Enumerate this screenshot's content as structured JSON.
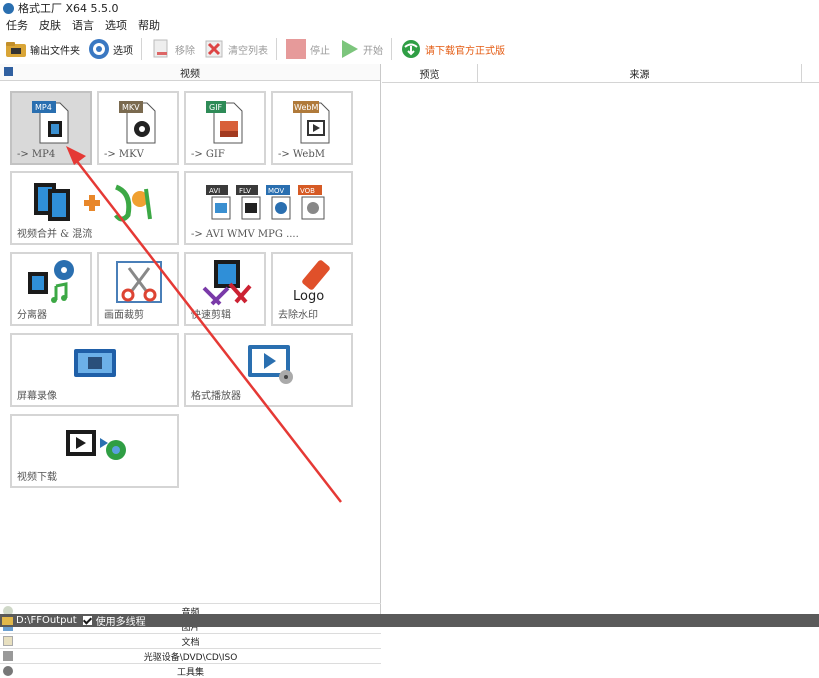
{
  "window": {
    "title": "格式工厂 X64 5.5.0"
  },
  "menu": [
    "任务",
    "皮肤",
    "语言",
    "选项",
    "帮助"
  ],
  "toolbar": {
    "output_folder": "输出文件夹",
    "options": "选项",
    "remove": "移除",
    "clear_list": "清空列表",
    "stop": "停止",
    "start": "开始",
    "download_official": "请下载官方正式版"
  },
  "left": {
    "video_header": "视频",
    "tiles": [
      {
        "label": "-> MP4",
        "badge": "MP4",
        "icon": "mp4-file-icon"
      },
      {
        "label": "-> MKV",
        "badge": "MKV",
        "icon": "mkv-file-icon"
      },
      {
        "label": "-> GIF",
        "badge": "GIF",
        "icon": "gif-file-icon"
      },
      {
        "label": "-> WebM",
        "badge": "WebM",
        "icon": "webm-file-icon"
      },
      {
        "label": "视频合并 & 混流",
        "icon": "merge-mux-icon"
      },
      {
        "label": "-> AVI WMV MPG ....",
        "badges": [
          "AVI",
          "FLV",
          "MOV",
          "VOB"
        ],
        "icon": "other-formats-icon"
      },
      {
        "label": "分离器",
        "icon": "splitter-icon"
      },
      {
        "label": "画面裁剪",
        "icon": "crop-icon"
      },
      {
        "label": "快速剪辑",
        "icon": "quick-clip-icon"
      },
      {
        "label": "去除水印",
        "badge": "Logo",
        "icon": "remove-watermark-icon"
      },
      {
        "label": "屏幕录像",
        "icon": "screen-record-icon"
      },
      {
        "label": "格式播放器",
        "icon": "player-icon"
      },
      {
        "label": "视频下载",
        "icon": "video-download-icon"
      }
    ],
    "categories": [
      "音频",
      "图片",
      "文档",
      "光驱设备\\DVD\\CD\\ISO",
      "工具集"
    ]
  },
  "right": {
    "columns": [
      "预览",
      "来源"
    ]
  },
  "status": {
    "path": "D:\\FFOutput",
    "multithread": "使用多线程"
  },
  "colors": {
    "accent": "#2a6fb0",
    "promo": "#e45b12",
    "annotation_arrow": "#e53935"
  }
}
